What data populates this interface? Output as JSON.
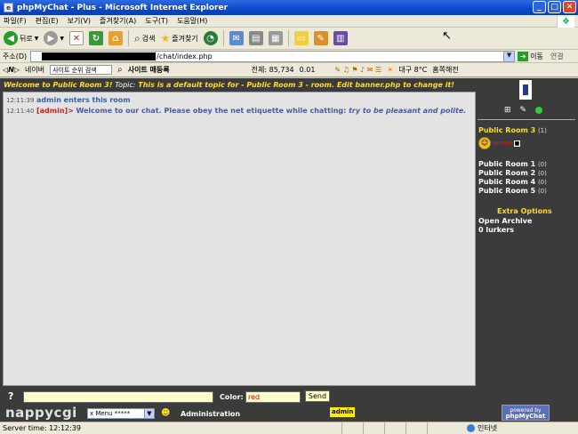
{
  "window": {
    "title": "phpMyChat - Plus - Microsoft Internet Explorer",
    "buttons": [
      "_",
      "□",
      "✕"
    ]
  },
  "menu": [
    "파일(F)",
    "편집(E)",
    "보기(V)",
    "즐겨찾기(A)",
    "도구(T)",
    "도움말(H)"
  ],
  "toolbar": {
    "back": "뒤로",
    "search": "검색",
    "favorites": "즐겨찾기"
  },
  "address": {
    "label": "주소(D)",
    "url_suffix": "/chat/index.php",
    "go": "이동",
    "links": "연결"
  },
  "linksbar": {
    "naver": "네이버",
    "search_placeholder": "사이트 순위 검색",
    "site_register": "사이트 매등록",
    "total": "전체: 85,734",
    "change": "0.01",
    "weather": "대구 8°C",
    "home": "홈쪽해전"
  },
  "chat": {
    "topic_welcome": "Welcome to Public Room 3!",
    "topic_label": "Topic:",
    "topic_text": "This is a default topic for - Public Room 3 - room. Edit banner.php to change it!",
    "messages": [
      {
        "time": "12:11:39",
        "text": "admin enters this room"
      },
      {
        "time": "12:11:40",
        "user": "[admin]>",
        "text": "Welcome to our chat. Please obey the net etiquette while chatting:",
        "em": "try to be pleasant and polite."
      }
    ]
  },
  "side": {
    "active_room": "Public Room 3",
    "active_count": "(1)",
    "user_name": "admin",
    "rooms": [
      {
        "name": "Public Room 1",
        "count": "(0)"
      },
      {
        "name": "Public Room 2",
        "count": "(0)"
      },
      {
        "name": "Public Room 4",
        "count": "(0)"
      },
      {
        "name": "Public Room 5",
        "count": "(0)"
      }
    ],
    "extra_title": "Extra Options",
    "open_archive": "Open Archive",
    "lurkers": "0 lurkers"
  },
  "input": {
    "help": "?",
    "color_label": "Color:",
    "color_value": "red",
    "send": "Send",
    "menu_select": "x Menu *****",
    "administration": "Administration",
    "admin_user": "admin",
    "powered_line1": "powered by",
    "powered_line2": "phpMyChat"
  },
  "watermark": "nappycgi",
  "status": {
    "text": "Server time: 12:12:39",
    "zone": "인터넷"
  }
}
